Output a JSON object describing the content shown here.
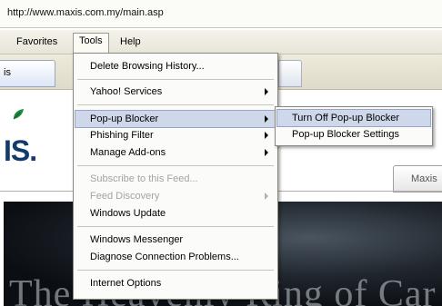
{
  "address": {
    "url": "http://www.maxis.com.my/main.asp"
  },
  "menubar": {
    "favorites": "Favorites",
    "tools": "Tools",
    "help": "Help"
  },
  "tabs": {
    "left_tab_fragment": "is"
  },
  "page": {
    "logo_text": "IS.",
    "tab_label": "Maxis",
    "banner_text": "The Heavenly Ring of Car"
  },
  "tools_menu": {
    "items": [
      {
        "label": "Delete Browsing History..."
      },
      {
        "label": "Yahoo! Services"
      },
      {
        "label": "Pop-up Blocker"
      },
      {
        "label": "Phishing Filter"
      },
      {
        "label": "Manage Add-ons"
      },
      {
        "label": "Subscribe to this Feed..."
      },
      {
        "label": "Feed Discovery"
      },
      {
        "label": "Windows Update"
      },
      {
        "label": "Windows Messenger"
      },
      {
        "label": "Diagnose Connection Problems..."
      },
      {
        "label": "Internet Options"
      }
    ]
  },
  "popup_submenu": {
    "items": [
      {
        "label": "Turn Off Pop-up Blocker"
      },
      {
        "label": "Pop-up Blocker Settings"
      }
    ]
  },
  "colors": {
    "highlight": "#cfd8ea",
    "disabled_text": "#a6a49b",
    "logo": "#123b6d"
  }
}
